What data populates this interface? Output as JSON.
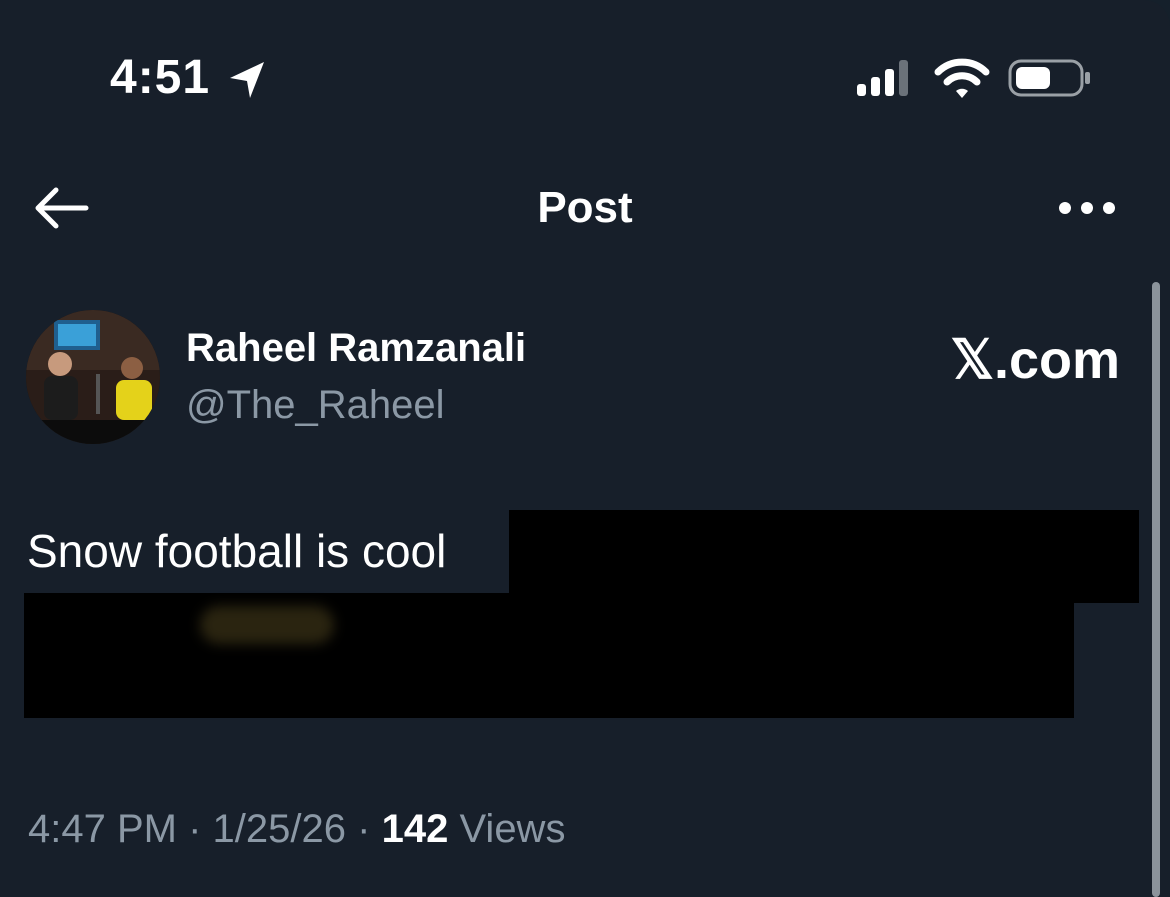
{
  "status_bar": {
    "time": "4:51",
    "icons": [
      "location-arrow-icon",
      "cellular-signal-icon",
      "wifi-icon",
      "battery-icon"
    ]
  },
  "header": {
    "title": "Post",
    "back_icon": "arrow-left-icon",
    "more_icon": "ellipsis-icon"
  },
  "author": {
    "display_name": "Raheel Ramzanali",
    "handle": "@The_Raheel"
  },
  "watermark": "𝕏.com",
  "post": {
    "text": "Snow football is cool"
  },
  "meta": {
    "time": "4:47 PM",
    "separator": "·",
    "date": "1/25/26",
    "views_count": "142",
    "views_label": "Views"
  },
  "colors": {
    "background": "#171f2a",
    "secondary_text": "#8b98a5",
    "primary_text": "#ffffff",
    "redaction": "#000000"
  }
}
